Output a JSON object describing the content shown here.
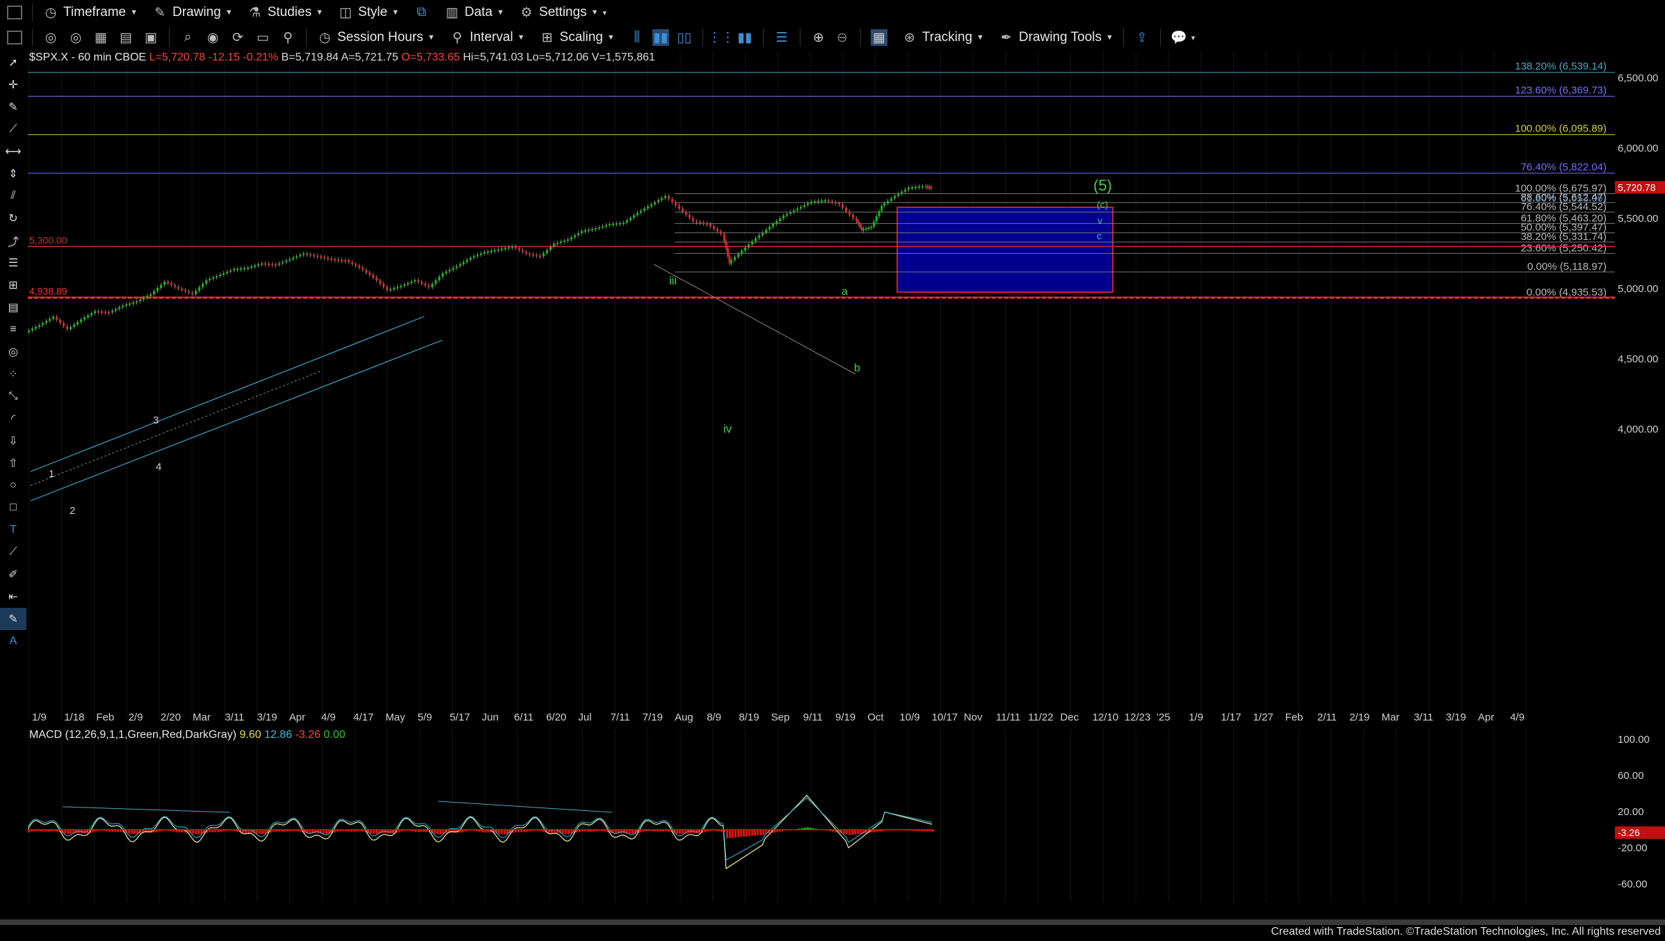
{
  "toolbar1": {
    "timeframe": "Timeframe",
    "drawing": "Drawing",
    "studies": "Studies",
    "style": "Style",
    "data": "Data",
    "settings": "Settings"
  },
  "toolbar2": {
    "session_hours": "Session Hours",
    "interval": "Interval",
    "scaling": "Scaling",
    "tracking": "Tracking",
    "drawing_tools": "Drawing Tools"
  },
  "symbol": {
    "name": "$SPX.X - 60 min  CBOE",
    "last": "L=5,720.78",
    "change": "-12.15",
    "pct": "-0.21%",
    "bid": "B=5,719.84",
    "ask": "A=5,721.75",
    "open": "O=5,733.65",
    "high": "Hi=5,741.03",
    "low": "Lo=5,712.06",
    "volume": "V=1,575,861"
  },
  "colors": {
    "up": "#00c000",
    "down": "#e02020",
    "accent": "#3a8fd8"
  },
  "price_axis": {
    "ticks": [
      {
        "label": "6,500.00",
        "value": 6500
      },
      {
        "label": "6,000.00",
        "value": 6000
      },
      {
        "label": "5,500.00",
        "value": 5500
      },
      {
        "label": "5,000.00",
        "value": 5000
      },
      {
        "label": "4,500.00",
        "value": 4500
      },
      {
        "label": "4,000.00",
        "value": 4000
      }
    ],
    "current": "5,720.78"
  },
  "fib_levels_upper": [
    {
      "label": "138.20% (6,539.14)",
      "value": 6539.14,
      "color": "#4aa8c0"
    },
    {
      "label": "123.60% (6,369.73)",
      "value": 6369.73,
      "color": "#7070ff"
    },
    {
      "label": "100.00% (6,095.89)",
      "value": 6095.89,
      "color": "#d0d040"
    },
    {
      "label": "76.40% (5,822.04)",
      "value": 5822.04,
      "color": "#7070ff"
    }
  ],
  "fib_levels_lower": [
    {
      "label": "100.00% (5,675.97)",
      "value": 5675.97
    },
    {
      "label": "61.80% (5,653.06)",
      "value": 5653.06
    },
    {
      "label": "88.60% (5,612.47)",
      "value": 5612.47
    },
    {
      "label": "76.40% (5,544.52)",
      "value": 5544.52
    },
    {
      "label": "61.80% (5,463.20)",
      "value": 5463.2
    },
    {
      "label": "50.00% (5,397.47)",
      "value": 5397.47
    },
    {
      "label": "38.20% (5,331.74)",
      "value": 5331.74
    },
    {
      "label": "23.60% (5,250.42)",
      "value": 5250.42
    },
    {
      "label": "0.00% (5,118.97)",
      "value": 5118.97
    },
    {
      "label": "0.00% (4,935.53)",
      "value": 4935.53
    }
  ],
  "horizontal_lines": [
    {
      "label": "5,300.00",
      "value": 5300,
      "color": "#c03030"
    },
    {
      "label": "4,938.89",
      "value": 4938.89,
      "color": "#ff3030"
    }
  ],
  "wave_labels": [
    "1",
    "2",
    "3",
    "4",
    "iii",
    "iv",
    "a",
    "b",
    "(5)",
    "(c)",
    "v",
    "c"
  ],
  "macd": {
    "label": "MACD (12,26,9,1,1,Green,Red,DarkGray)",
    "v1": "9.60",
    "v2": "12.86",
    "v3": "-3.26",
    "v4": "0.00",
    "ticks": [
      {
        "label": "100.00",
        "value": 100
      },
      {
        "label": "60.00",
        "value": 60
      },
      {
        "label": "20.00",
        "value": 20
      },
      {
        "label": "-20.00",
        "value": -20
      },
      {
        "label": "-60.00",
        "value": -60
      }
    ],
    "current": "-3.26"
  },
  "time_axis": [
    "1/9",
    "1/18",
    "Feb",
    "2/9",
    "2/20",
    "Mar",
    "3/11",
    "3/19",
    "Apr",
    "4/9",
    "4/17",
    "May",
    "5/9",
    "5/17",
    "Jun",
    "6/11",
    "6/20",
    "Jul",
    "7/11",
    "7/19",
    "Aug",
    "8/9",
    "8/19",
    "Sep",
    "9/11",
    "9/19",
    "Oct",
    "10/9",
    "10/17",
    "Nov",
    "11/11",
    "11/22",
    "Dec",
    "12/10",
    "12/23",
    "'25",
    "1/9",
    "1/17",
    "1/27",
    "Feb",
    "2/11",
    "2/19",
    "Mar",
    "3/11",
    "3/19",
    "Apr",
    "4/9"
  ],
  "footer": "Created with TradeStation. ©TradeStation Technologies, Inc. All rights reserved"
}
